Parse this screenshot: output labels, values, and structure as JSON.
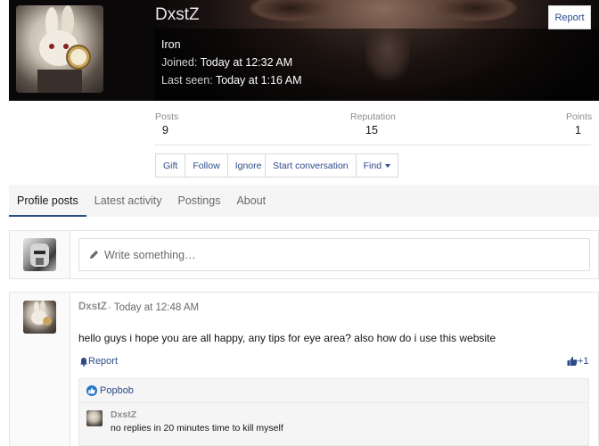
{
  "profile": {
    "username": "DxstZ",
    "title": "Iron",
    "joined_label": "Joined:",
    "joined_value": "Today at 12:32 AM",
    "last_seen_label": "Last seen:",
    "last_seen_value": "Today at 1:16 AM",
    "report_label": "Report"
  },
  "stats": [
    {
      "label": "Posts",
      "value": "9"
    },
    {
      "label": "Reputation",
      "value": "15"
    },
    {
      "label": "Points",
      "value": "1"
    }
  ],
  "actions": {
    "group1": [
      "Gift",
      "Follow",
      "Ignore"
    ],
    "group2": [
      "Start conversation",
      "Find"
    ]
  },
  "tabs": [
    {
      "label": "Profile posts",
      "active": true
    },
    {
      "label": "Latest activity",
      "active": false
    },
    {
      "label": "Postings",
      "active": false
    },
    {
      "label": "About",
      "active": false
    }
  ],
  "composer": {
    "placeholder": "Write something…"
  },
  "post": {
    "author": "DxstZ",
    "separator": "·",
    "time": "Today at 12:48 AM",
    "text": "hello guys i hope you are all happy, any tips for eye area? also how do i use this website",
    "report_label": "Report",
    "like_label": "+1",
    "liked_by": "Popbob"
  },
  "comment": {
    "author": "DxstZ",
    "text": "no replies in 20 minutes time to kill myself"
  },
  "colors": {
    "link": "#2b4a8a",
    "accent_tab": "#2b4a8a",
    "like_badge": "#2577c9"
  }
}
